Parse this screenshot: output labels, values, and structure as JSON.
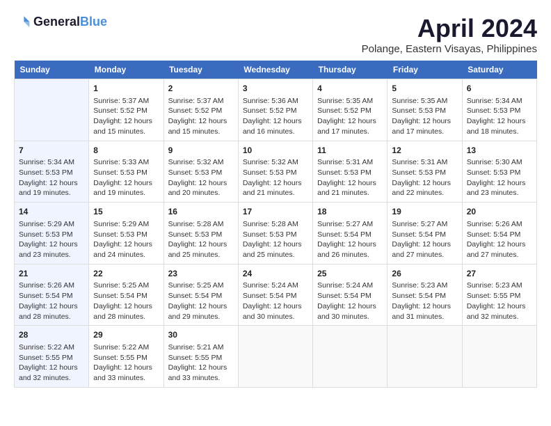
{
  "logo": {
    "line1": "General",
    "line2": "Blue"
  },
  "title": "April 2024",
  "location": "Polange, Eastern Visayas, Philippines",
  "days_of_week": [
    "Sunday",
    "Monday",
    "Tuesday",
    "Wednesday",
    "Thursday",
    "Friday",
    "Saturday"
  ],
  "weeks": [
    [
      {
        "day": "",
        "sunrise": "",
        "sunset": "",
        "daylight": ""
      },
      {
        "day": "1",
        "sunrise": "Sunrise: 5:37 AM",
        "sunset": "Sunset: 5:52 PM",
        "daylight": "Daylight: 12 hours and 15 minutes."
      },
      {
        "day": "2",
        "sunrise": "Sunrise: 5:37 AM",
        "sunset": "Sunset: 5:52 PM",
        "daylight": "Daylight: 12 hours and 15 minutes."
      },
      {
        "day": "3",
        "sunrise": "Sunrise: 5:36 AM",
        "sunset": "Sunset: 5:52 PM",
        "daylight": "Daylight: 12 hours and 16 minutes."
      },
      {
        "day": "4",
        "sunrise": "Sunrise: 5:35 AM",
        "sunset": "Sunset: 5:52 PM",
        "daylight": "Daylight: 12 hours and 17 minutes."
      },
      {
        "day": "5",
        "sunrise": "Sunrise: 5:35 AM",
        "sunset": "Sunset: 5:53 PM",
        "daylight": "Daylight: 12 hours and 17 minutes."
      },
      {
        "day": "6",
        "sunrise": "Sunrise: 5:34 AM",
        "sunset": "Sunset: 5:53 PM",
        "daylight": "Daylight: 12 hours and 18 minutes."
      }
    ],
    [
      {
        "day": "7",
        "sunrise": "Sunrise: 5:34 AM",
        "sunset": "Sunset: 5:53 PM",
        "daylight": "Daylight: 12 hours and 19 minutes."
      },
      {
        "day": "8",
        "sunrise": "Sunrise: 5:33 AM",
        "sunset": "Sunset: 5:53 PM",
        "daylight": "Daylight: 12 hours and 19 minutes."
      },
      {
        "day": "9",
        "sunrise": "Sunrise: 5:32 AM",
        "sunset": "Sunset: 5:53 PM",
        "daylight": "Daylight: 12 hours and 20 minutes."
      },
      {
        "day": "10",
        "sunrise": "Sunrise: 5:32 AM",
        "sunset": "Sunset: 5:53 PM",
        "daylight": "Daylight: 12 hours and 21 minutes."
      },
      {
        "day": "11",
        "sunrise": "Sunrise: 5:31 AM",
        "sunset": "Sunset: 5:53 PM",
        "daylight": "Daylight: 12 hours and 21 minutes."
      },
      {
        "day": "12",
        "sunrise": "Sunrise: 5:31 AM",
        "sunset": "Sunset: 5:53 PM",
        "daylight": "Daylight: 12 hours and 22 minutes."
      },
      {
        "day": "13",
        "sunrise": "Sunrise: 5:30 AM",
        "sunset": "Sunset: 5:53 PM",
        "daylight": "Daylight: 12 hours and 23 minutes."
      }
    ],
    [
      {
        "day": "14",
        "sunrise": "Sunrise: 5:29 AM",
        "sunset": "Sunset: 5:53 PM",
        "daylight": "Daylight: 12 hours and 23 minutes."
      },
      {
        "day": "15",
        "sunrise": "Sunrise: 5:29 AM",
        "sunset": "Sunset: 5:53 PM",
        "daylight": "Daylight: 12 hours and 24 minutes."
      },
      {
        "day": "16",
        "sunrise": "Sunrise: 5:28 AM",
        "sunset": "Sunset: 5:53 PM",
        "daylight": "Daylight: 12 hours and 25 minutes."
      },
      {
        "day": "17",
        "sunrise": "Sunrise: 5:28 AM",
        "sunset": "Sunset: 5:53 PM",
        "daylight": "Daylight: 12 hours and 25 minutes."
      },
      {
        "day": "18",
        "sunrise": "Sunrise: 5:27 AM",
        "sunset": "Sunset: 5:54 PM",
        "daylight": "Daylight: 12 hours and 26 minutes."
      },
      {
        "day": "19",
        "sunrise": "Sunrise: 5:27 AM",
        "sunset": "Sunset: 5:54 PM",
        "daylight": "Daylight: 12 hours and 27 minutes."
      },
      {
        "day": "20",
        "sunrise": "Sunrise: 5:26 AM",
        "sunset": "Sunset: 5:54 PM",
        "daylight": "Daylight: 12 hours and 27 minutes."
      }
    ],
    [
      {
        "day": "21",
        "sunrise": "Sunrise: 5:26 AM",
        "sunset": "Sunset: 5:54 PM",
        "daylight": "Daylight: 12 hours and 28 minutes."
      },
      {
        "day": "22",
        "sunrise": "Sunrise: 5:25 AM",
        "sunset": "Sunset: 5:54 PM",
        "daylight": "Daylight: 12 hours and 28 minutes."
      },
      {
        "day": "23",
        "sunrise": "Sunrise: 5:25 AM",
        "sunset": "Sunset: 5:54 PM",
        "daylight": "Daylight: 12 hours and 29 minutes."
      },
      {
        "day": "24",
        "sunrise": "Sunrise: 5:24 AM",
        "sunset": "Sunset: 5:54 PM",
        "daylight": "Daylight: 12 hours and 30 minutes."
      },
      {
        "day": "25",
        "sunrise": "Sunrise: 5:24 AM",
        "sunset": "Sunset: 5:54 PM",
        "daylight": "Daylight: 12 hours and 30 minutes."
      },
      {
        "day": "26",
        "sunrise": "Sunrise: 5:23 AM",
        "sunset": "Sunset: 5:54 PM",
        "daylight": "Daylight: 12 hours and 31 minutes."
      },
      {
        "day": "27",
        "sunrise": "Sunrise: 5:23 AM",
        "sunset": "Sunset: 5:55 PM",
        "daylight": "Daylight: 12 hours and 32 minutes."
      }
    ],
    [
      {
        "day": "28",
        "sunrise": "Sunrise: 5:22 AM",
        "sunset": "Sunset: 5:55 PM",
        "daylight": "Daylight: 12 hours and 32 minutes."
      },
      {
        "day": "29",
        "sunrise": "Sunrise: 5:22 AM",
        "sunset": "Sunset: 5:55 PM",
        "daylight": "Daylight: 12 hours and 33 minutes."
      },
      {
        "day": "30",
        "sunrise": "Sunrise: 5:21 AM",
        "sunset": "Sunset: 5:55 PM",
        "daylight": "Daylight: 12 hours and 33 minutes."
      },
      {
        "day": "",
        "sunrise": "",
        "sunset": "",
        "daylight": ""
      },
      {
        "day": "",
        "sunrise": "",
        "sunset": "",
        "daylight": ""
      },
      {
        "day": "",
        "sunrise": "",
        "sunset": "",
        "daylight": ""
      },
      {
        "day": "",
        "sunrise": "",
        "sunset": "",
        "daylight": ""
      }
    ]
  ]
}
